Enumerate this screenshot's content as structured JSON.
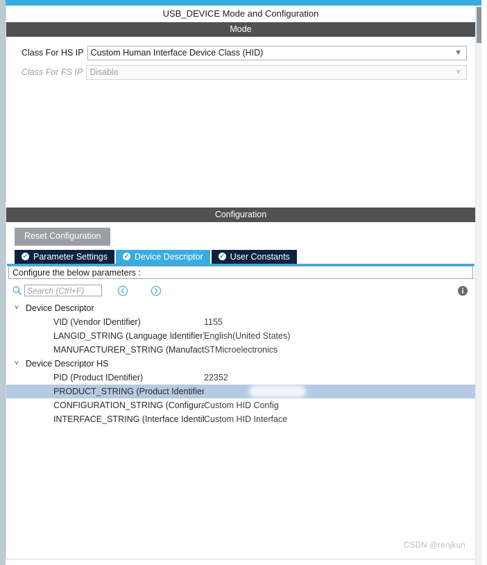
{
  "window": {
    "title": "USB_DEVICE Mode and Configuration"
  },
  "mode_section": {
    "header": "Mode",
    "fields": [
      {
        "label": "Class For HS IP",
        "value": "Custom Human Interface Device Class (HID)",
        "disabled": false
      },
      {
        "label": "Class For FS IP",
        "value": "Disable",
        "disabled": true
      }
    ]
  },
  "configuration_section": {
    "header": "Configuration",
    "reset_label": "Reset Configuration",
    "tabs": [
      {
        "label": "Parameter Settings",
        "active": false,
        "icon": "check-circle-icon"
      },
      {
        "label": "Device Descriptor",
        "active": true,
        "icon": "check-circle-icon"
      },
      {
        "label": "User Constants",
        "active": false,
        "icon": "check-circle-icon"
      }
    ],
    "configure_hint": "Configure the below parameters :",
    "search": {
      "placeholder": "Search (Ctrl+F)",
      "value": "",
      "icon": "search-icon"
    },
    "nav": {
      "back_icon": "circle-arrow-left-icon",
      "forward_icon": "circle-arrow-right-icon"
    },
    "info_icon": "info-icon",
    "tree": [
      {
        "group": "Device Descriptor",
        "expanded": true,
        "rows": [
          {
            "name": "VID (Vendor IDentifier)",
            "value": "1155",
            "selected": false,
            "redacted": false
          },
          {
            "name": "LANGID_STRING (Language Identifier)",
            "value": "English(United States)",
            "selected": false,
            "redacted": false
          },
          {
            "name": "MANUFACTURER_STRING (Manufacturer Ide...",
            "value": "STMicroelectronics",
            "selected": false,
            "redacted": false
          }
        ]
      },
      {
        "group": "Device Descriptor HS",
        "expanded": true,
        "rows": [
          {
            "name": "PID (Product IDentifier)",
            "value": "22352",
            "selected": false,
            "redacted": false
          },
          {
            "name": "PRODUCT_STRING (Product Identifier)",
            "value": "",
            "selected": true,
            "redacted": true
          },
          {
            "name": "CONFIGURATION_STRING (Configuration Ide...",
            "value": "Custom HID Config",
            "selected": false,
            "redacted": false
          },
          {
            "name": "INTERFACE_STRING (Interface Identifier)",
            "value": "Custom HID Interface",
            "selected": false,
            "redacted": false
          }
        ]
      }
    ]
  },
  "watermark": "CSDN @renjkun",
  "colors": {
    "accent": "#39acdf",
    "header_bar": "#515151",
    "tab_inactive": "#0c2340",
    "selection": "#b6cbe3",
    "disabled_text": "#9aa0a6"
  }
}
